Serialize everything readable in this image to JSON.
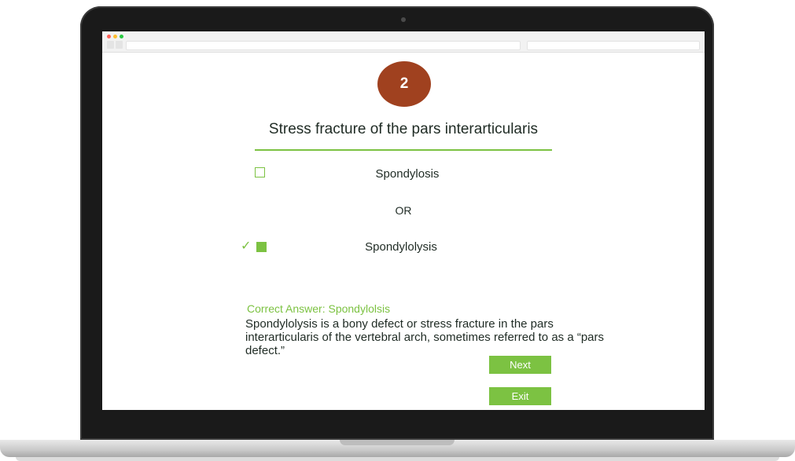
{
  "quiz": {
    "question_number": "2",
    "question": "Stress fracture of the pars interarticularis",
    "options": [
      {
        "label": "Spondylosis",
        "selected": false
      },
      {
        "label": "Spondylolysis",
        "selected": true
      }
    ],
    "separator": "OR",
    "check_icon": "check-icon",
    "correct_answer": "Correct Answer: Spondylolsis",
    "explanation": "Spondylolysis is a bony defect or stress fracture in the pars interarticularis of the vertebral arch, sometimes referred to as a “pars defect.”",
    "buttons": {
      "next": "Next",
      "exit": "Exit"
    }
  },
  "colors": {
    "accent_green": "#7cc242",
    "badge_brown": "#a0411f",
    "text_dark": "#1f2b24"
  }
}
